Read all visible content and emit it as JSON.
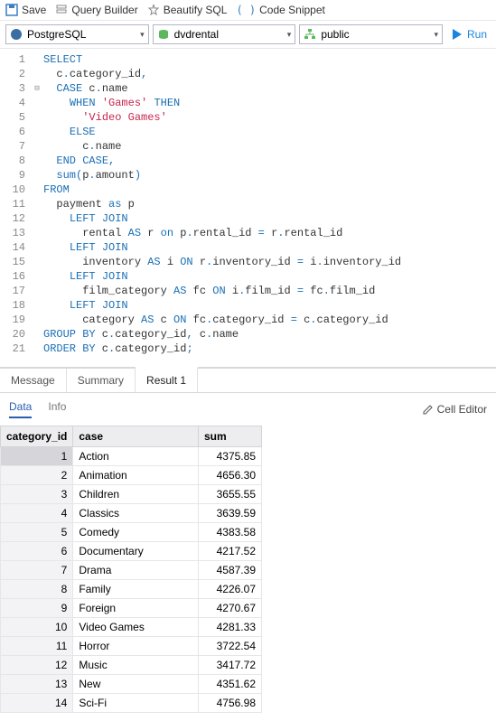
{
  "toolbar1": {
    "save": "Save",
    "query_builder": "Query Builder",
    "beautify": "Beautify SQL",
    "code_snippet": "Code Snippet"
  },
  "toolbar2": {
    "db_type": "PostgreSQL",
    "database": "dvdrental",
    "schema": "public",
    "run": "Run"
  },
  "code": {
    "lines": [
      {
        "n": "1",
        "fold": "",
        "tokens": [
          [
            "kw",
            "SELECT"
          ]
        ]
      },
      {
        "n": "2",
        "fold": "",
        "tokens": [
          [
            "id",
            "  c"
          ],
          [
            "kw",
            "."
          ],
          [
            "id",
            "category_id"
          ],
          [
            "kw",
            ","
          ]
        ]
      },
      {
        "n": "3",
        "fold": "⊟",
        "tokens": [
          [
            "id",
            "  "
          ],
          [
            "kw",
            "CASE"
          ],
          [
            "id",
            " c"
          ],
          [
            "kw",
            "."
          ],
          [
            "id",
            "name"
          ]
        ]
      },
      {
        "n": "4",
        "fold": "",
        "tokens": [
          [
            "id",
            "    "
          ],
          [
            "kw",
            "WHEN"
          ],
          [
            "id",
            " "
          ],
          [
            "str",
            "'Games'"
          ],
          [
            "id",
            " "
          ],
          [
            "kw",
            "THEN"
          ]
        ]
      },
      {
        "n": "5",
        "fold": "",
        "tokens": [
          [
            "id",
            "      "
          ],
          [
            "str",
            "'Video Games'"
          ]
        ]
      },
      {
        "n": "6",
        "fold": "",
        "tokens": [
          [
            "id",
            "    "
          ],
          [
            "kw",
            "ELSE"
          ]
        ]
      },
      {
        "n": "7",
        "fold": "",
        "tokens": [
          [
            "id",
            "      c"
          ],
          [
            "kw",
            "."
          ],
          [
            "id",
            "name"
          ]
        ]
      },
      {
        "n": "8",
        "fold": "",
        "tokens": [
          [
            "id",
            "  "
          ],
          [
            "kw",
            "END"
          ],
          [
            "id",
            " "
          ],
          [
            "kw",
            "CASE"
          ],
          [
            "kw",
            ","
          ]
        ]
      },
      {
        "n": "9",
        "fold": "",
        "tokens": [
          [
            "id",
            "  "
          ],
          [
            "kw",
            "sum"
          ],
          [
            "kw",
            "("
          ],
          [
            "id",
            "p"
          ],
          [
            "kw",
            "."
          ],
          [
            "id",
            "amount"
          ],
          [
            "kw",
            ")"
          ]
        ]
      },
      {
        "n": "10",
        "fold": "",
        "tokens": [
          [
            "kw",
            "FROM"
          ]
        ]
      },
      {
        "n": "11",
        "fold": "",
        "tokens": [
          [
            "id",
            "  payment "
          ],
          [
            "kw",
            "as"
          ],
          [
            "id",
            " p"
          ]
        ]
      },
      {
        "n": "12",
        "fold": "",
        "tokens": [
          [
            "id",
            "    "
          ],
          [
            "kw",
            "LEFT JOIN"
          ]
        ]
      },
      {
        "n": "13",
        "fold": "",
        "tokens": [
          [
            "id",
            "      rental "
          ],
          [
            "kw",
            "AS"
          ],
          [
            "id",
            " r "
          ],
          [
            "kw",
            "on"
          ],
          [
            "id",
            " p"
          ],
          [
            "kw",
            "."
          ],
          [
            "id",
            "rental_id "
          ],
          [
            "kw",
            "="
          ],
          [
            "id",
            " r"
          ],
          [
            "kw",
            "."
          ],
          [
            "id",
            "rental_id"
          ]
        ]
      },
      {
        "n": "14",
        "fold": "",
        "tokens": [
          [
            "id",
            "    "
          ],
          [
            "kw",
            "LEFT JOIN"
          ]
        ]
      },
      {
        "n": "15",
        "fold": "",
        "tokens": [
          [
            "id",
            "      inventory "
          ],
          [
            "kw",
            "AS"
          ],
          [
            "id",
            " i "
          ],
          [
            "kw",
            "ON"
          ],
          [
            "id",
            " r"
          ],
          [
            "kw",
            "."
          ],
          [
            "id",
            "inventory_id "
          ],
          [
            "kw",
            "="
          ],
          [
            "id",
            " i"
          ],
          [
            "kw",
            "."
          ],
          [
            "id",
            "inventory_id"
          ]
        ]
      },
      {
        "n": "16",
        "fold": "",
        "tokens": [
          [
            "id",
            "    "
          ],
          [
            "kw",
            "LEFT JOIN"
          ]
        ]
      },
      {
        "n": "17",
        "fold": "",
        "tokens": [
          [
            "id",
            "      film_category "
          ],
          [
            "kw",
            "AS"
          ],
          [
            "id",
            " fc "
          ],
          [
            "kw",
            "ON"
          ],
          [
            "id",
            " i"
          ],
          [
            "kw",
            "."
          ],
          [
            "id",
            "film_id "
          ],
          [
            "kw",
            "="
          ],
          [
            "id",
            " fc"
          ],
          [
            "kw",
            "."
          ],
          [
            "id",
            "film_id"
          ]
        ]
      },
      {
        "n": "18",
        "fold": "",
        "tokens": [
          [
            "id",
            "    "
          ],
          [
            "kw",
            "LEFT JOIN"
          ]
        ]
      },
      {
        "n": "19",
        "fold": "",
        "tokens": [
          [
            "id",
            "      category "
          ],
          [
            "kw",
            "AS"
          ],
          [
            "id",
            " c "
          ],
          [
            "kw",
            "ON"
          ],
          [
            "id",
            " fc"
          ],
          [
            "kw",
            "."
          ],
          [
            "id",
            "category_id "
          ],
          [
            "kw",
            "="
          ],
          [
            "id",
            " c"
          ],
          [
            "kw",
            "."
          ],
          [
            "id",
            "category_id"
          ]
        ]
      },
      {
        "n": "20",
        "fold": "",
        "tokens": [
          [
            "kw",
            "GROUP BY"
          ],
          [
            "id",
            " c"
          ],
          [
            "kw",
            "."
          ],
          [
            "id",
            "category_id"
          ],
          [
            "kw",
            ","
          ],
          [
            "id",
            " c"
          ],
          [
            "kw",
            "."
          ],
          [
            "id",
            "name"
          ]
        ]
      },
      {
        "n": "21",
        "fold": "",
        "tokens": [
          [
            "kw",
            "ORDER BY"
          ],
          [
            "id",
            " c"
          ],
          [
            "kw",
            "."
          ],
          [
            "id",
            "category_id"
          ],
          [
            "kw",
            ";"
          ]
        ]
      }
    ]
  },
  "sub_tabs": {
    "message": "Message",
    "summary": "Summary",
    "result1": "Result 1"
  },
  "data_tabs": {
    "data": "Data",
    "info": "Info",
    "cell_editor": "Cell Editor"
  },
  "results": {
    "headers": {
      "c1": "category_id",
      "c2": "case",
      "c3": "sum"
    },
    "rows": [
      {
        "id": "1",
        "case": "Action",
        "sum": "4375.85"
      },
      {
        "id": "2",
        "case": "Animation",
        "sum": "4656.30"
      },
      {
        "id": "3",
        "case": "Children",
        "sum": "3655.55"
      },
      {
        "id": "4",
        "case": "Classics",
        "sum": "3639.59"
      },
      {
        "id": "5",
        "case": "Comedy",
        "sum": "4383.58"
      },
      {
        "id": "6",
        "case": "Documentary",
        "sum": "4217.52"
      },
      {
        "id": "7",
        "case": "Drama",
        "sum": "4587.39"
      },
      {
        "id": "8",
        "case": "Family",
        "sum": "4226.07"
      },
      {
        "id": "9",
        "case": "Foreign",
        "sum": "4270.67"
      },
      {
        "id": "10",
        "case": "Video Games",
        "sum": "4281.33"
      },
      {
        "id": "11",
        "case": "Horror",
        "sum": "3722.54"
      },
      {
        "id": "12",
        "case": "Music",
        "sum": "3417.72"
      },
      {
        "id": "13",
        "case": "New",
        "sum": "4351.62"
      },
      {
        "id": "14",
        "case": "Sci-Fi",
        "sum": "4756.98"
      }
    ]
  }
}
